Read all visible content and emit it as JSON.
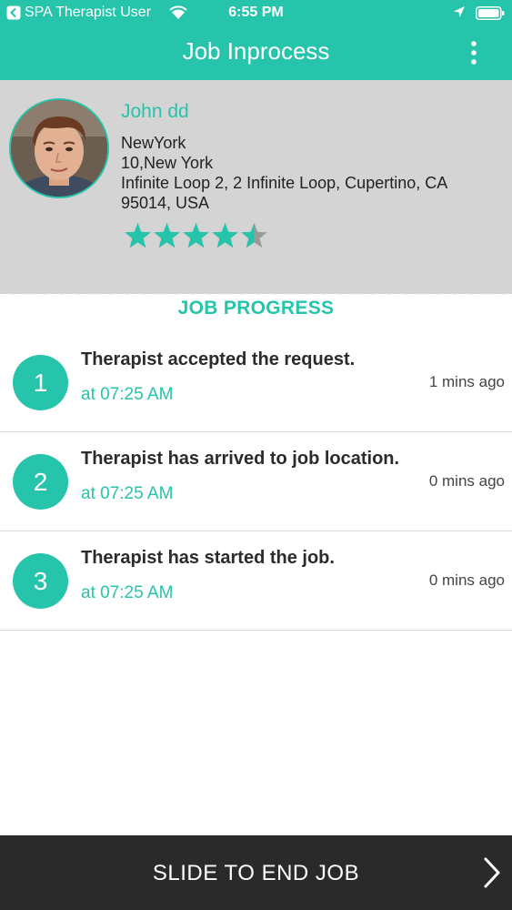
{
  "status_bar": {
    "carrier": "SPA Therapist User",
    "time": "6:55 PM",
    "icons": [
      "back-arrow-icon",
      "wifi-icon",
      "location-arrow-icon",
      "battery-icon"
    ]
  },
  "nav": {
    "title": "Job Inprocess",
    "menu_icon": "more-vertical-icon"
  },
  "profile": {
    "name": "John dd",
    "city": "NewYork",
    "region": "10,New York",
    "address": "Infinite Loop 2,  2 Infinite Loop,  Cupertino,  CA 95014,  USA",
    "rating": 4.5,
    "rating_max": 5
  },
  "job_progress": {
    "title": "JOB PROGRESS",
    "steps": [
      {
        "number": "1",
        "text": "Therapist accepted the request.",
        "time": "at 07:25 AM",
        "ago": "1 mins ago"
      },
      {
        "number": "2",
        "text": "Therapist has arrived to job location.",
        "time": "at 07:25 AM",
        "ago": "0 mins ago"
      },
      {
        "number": "3",
        "text": "Therapist has started the job.",
        "time": "at 07:25 AM",
        "ago": "0 mins ago"
      }
    ]
  },
  "slider": {
    "label": "SLIDE TO END JOB",
    "icon": "chevron-right-icon"
  },
  "colors": {
    "accent": "#26c4aa",
    "profile_bg": "#d4d4d4",
    "slider_bg": "#2a2a2a",
    "star_empty": "#9a9a9a"
  }
}
